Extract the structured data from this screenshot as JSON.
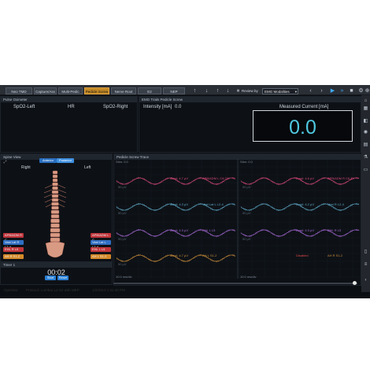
{
  "toolbar": {
    "tabs": [
      "Neo TMD",
      "Capture/Ass",
      "Multi-Pedic",
      "Pedicle Screw",
      "Nerve Root",
      "E2",
      "NEP"
    ],
    "active_tab": 3,
    "icons": [
      "upload-icon",
      "download-icon",
      "upload-icon",
      "download-icon",
      "pause-icon"
    ],
    "review_label": "Review by",
    "review_value": "EMG Modalities",
    "nav_icons": [
      "prev-icon",
      "next-icon",
      "play-icon",
      "fast-forward-icon",
      "stop-icon",
      "settings-icon",
      "lock-icon",
      "print-icon",
      "camera-icon"
    ]
  },
  "pulse_oximeter": {
    "title": "Pulse Oximeter",
    "labels": [
      "SpO2-Left",
      "HR",
      "SpO2-Right"
    ]
  },
  "stim": {
    "tabs": "EMG Trials  Pedicle Screw",
    "intensity_label": "Intensity [mA]",
    "intensity_value": "0.0",
    "measured_label": "Measured Current [mA]",
    "measured_value": "0.0"
  },
  "spine_view": {
    "title": "Spine View",
    "view_buttons": [
      "Anterior",
      "Posterior"
    ],
    "right_label": "Right",
    "left_label": "Left",
    "right_tags": [
      "APB/ADM R C",
      "Vast Lat R L2-4",
      "EHL R L5",
      "AH R S1-2"
    ],
    "left_tags": [
      "APB/ADM L C",
      "Vast Lat L L2-4",
      "EHL L L5",
      "AH L S1-2"
    ]
  },
  "timer": {
    "title": "Timer 1",
    "value": "00:02",
    "buttons": [
      "Start",
      "Reset"
    ]
  },
  "traces": {
    "title": "Pedicle Screw Trace",
    "left_header": "Stim: 0.0",
    "right_header": "Stim: 0.0",
    "left_channels": [
      {
        "left": "Ampl: 4.7 μV",
        "right": "APB/ADM L C6-T1",
        "scale": "50 μV",
        "color": "#d94878"
      },
      {
        "left": "Ampl: 4.3 μV",
        "right": "Vast Lat L L2-4",
        "scale": "50 μV",
        "color": "#5fa8c6"
      },
      {
        "left": "Ampl: 4.3 μV",
        "right": "EHL L L5",
        "scale": "50 μV",
        "color": "#a768d6"
      },
      {
        "left": "Ampl: 4.7 μV",
        "right": "AH L S1-2",
        "scale": "50 μV",
        "color": "#c98c3a"
      }
    ],
    "right_channels": [
      {
        "left": "Ampl: 4.6 μV",
        "right": "APB/ADM R C6-T1",
        "scale": "50 μV",
        "color": "#d94878"
      },
      {
        "left": "Ampl: 4.2 μV",
        "right": "Vast R L2-4",
        "scale": "50 μV",
        "color": "#5fa8c6"
      },
      {
        "left": "Ampl: 4.3 μV",
        "right": "EHL R L5",
        "scale": "50 μV",
        "color": "#a768d6"
      },
      {
        "left": "Disabled",
        "right": "AH R S1-2",
        "scale": "",
        "color": "#c98c3a"
      }
    ],
    "left_footer": "10.0 ms/div",
    "right_footer": "10.0 ms/div"
  },
  "footer": {
    "operator": "Operator:",
    "protocol": "Protocol: Lumbar L2-S2 with MEP",
    "date": "1/2/2013 1:41:30 PM"
  },
  "colors": {
    "accent": "#4fc8e0",
    "active_tab": "#c58a26",
    "tag_red": "#c0353b",
    "tag_blue": "#2f6fc4",
    "tag_orange": "#d48a2a"
  }
}
